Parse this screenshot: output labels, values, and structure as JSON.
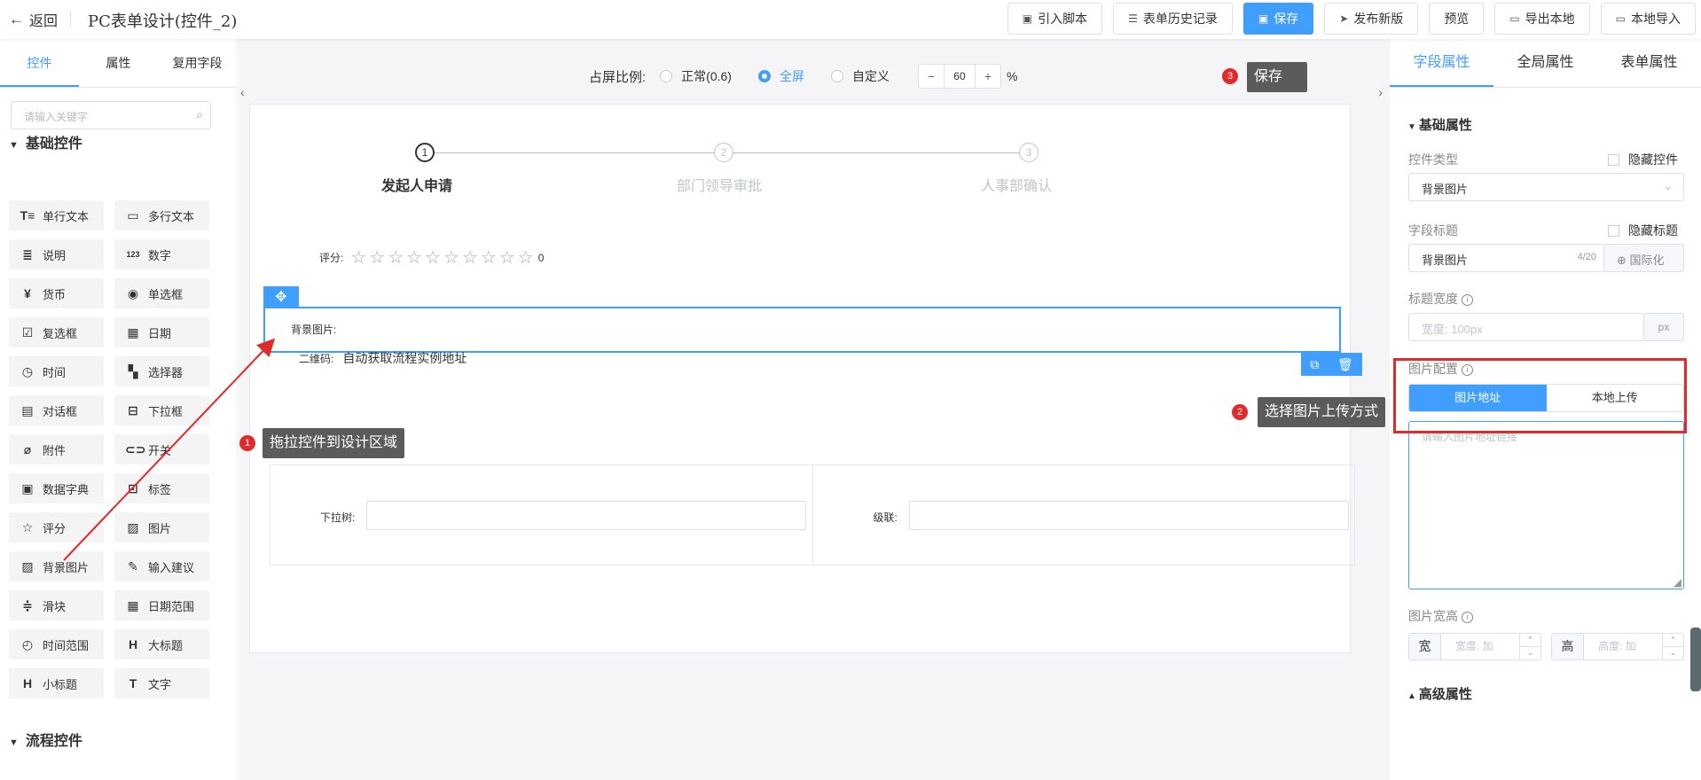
{
  "topbar": {
    "back": "返回",
    "title": "PC表单设计(控件_2)",
    "buttons": [
      "引入脚本",
      "表单历史记录",
      "保存",
      "发布新版",
      "预览",
      "导出本地",
      "本地导入"
    ]
  },
  "left": {
    "tabs": [
      "控件",
      "属性",
      "复用字段"
    ],
    "search_placeholder": "请输入关键字",
    "section_basic": "基础控件",
    "section_flow": "流程控件",
    "controls": [
      {
        "label": "单行文本",
        "icon": "T≡"
      },
      {
        "label": "多行文本",
        "icon": "▭"
      },
      {
        "label": "说明",
        "icon": "≣"
      },
      {
        "label": "数字",
        "icon": "123"
      },
      {
        "label": "货币",
        "icon": "¥"
      },
      {
        "label": "单选框",
        "icon": "◉"
      },
      {
        "label": "复选框",
        "icon": "☑"
      },
      {
        "label": "日期",
        "icon": "▦"
      },
      {
        "label": "时间",
        "icon": "◷"
      },
      {
        "label": "选择器",
        "icon": "▚"
      },
      {
        "label": "对话框",
        "icon": "▤"
      },
      {
        "label": "下拉框",
        "icon": "⊟"
      },
      {
        "label": "附件",
        "icon": "⌀"
      },
      {
        "label": "开关",
        "icon": "⊂⊃"
      },
      {
        "label": "数据字典",
        "icon": "▣"
      },
      {
        "label": "标签",
        "icon": "⊡"
      },
      {
        "label": "评分",
        "icon": "☆"
      },
      {
        "label": "图片",
        "icon": "▨"
      },
      {
        "label": "背景图片",
        "icon": "▨"
      },
      {
        "label": "输入建议",
        "icon": "✎"
      },
      {
        "label": "滑块",
        "icon": "≑"
      },
      {
        "label": "日期范围",
        "icon": "▦"
      },
      {
        "label": "时间范围",
        "icon": "◴"
      },
      {
        "label": "大标题",
        "icon": "H"
      },
      {
        "label": "小标题",
        "icon": "H"
      },
      {
        "label": "文字",
        "icon": "T"
      }
    ]
  },
  "center": {
    "ratio_label": "占屏比例:",
    "ratio_options": [
      "正常(0.6)",
      "全屏",
      "自定义"
    ],
    "ratio_selected": "全屏",
    "custom_value": "60",
    "percent": "%",
    "minus": "−",
    "plus": "+",
    "steps": [
      "发起人申请",
      "部门领导审批",
      "人事部确认"
    ],
    "step_numbers": [
      "1",
      "2",
      "3"
    ],
    "rating_label": "评分:",
    "rating_value": "0",
    "rating_stars": 10,
    "bg_image_label": "背景图片:",
    "qrcode_label": "二维码:",
    "qrcode_text": "自动获取流程实例地址",
    "tree_label": "下拉树:",
    "cascade_label": "级联:"
  },
  "callouts": {
    "c1": {
      "num": "1",
      "text": "拖拉控件到设计区域"
    },
    "c2": {
      "num": "2",
      "text": "选择图片上传方式"
    },
    "c3": {
      "num": "3",
      "text": "保存"
    }
  },
  "right": {
    "tabs": [
      "字段属性",
      "全局属性",
      "表单属性"
    ],
    "basic_section": "基础属性",
    "control_type_label": "控件类型",
    "hide_control": "隐藏控件",
    "control_type_value": "背景图片",
    "field_title_label": "字段标题",
    "hide_title": "隐藏标题",
    "field_title_value": "背景图片",
    "field_title_count": "4/20",
    "i18n": "国际化",
    "title_width_label": "标题宽度",
    "title_width_placeholder": "宽度: 100px",
    "px": "px",
    "image_config_label": "图片配置",
    "image_source_options": [
      "图片地址",
      "本地上传"
    ],
    "image_url_placeholder": "请输入图片地址链接",
    "image_size_label": "图片宽高",
    "width_label": "宽",
    "height_label": "高",
    "width_placeholder": "宽度: 加",
    "height_placeholder": "高度: 加",
    "advanced_section": "高级属性"
  }
}
